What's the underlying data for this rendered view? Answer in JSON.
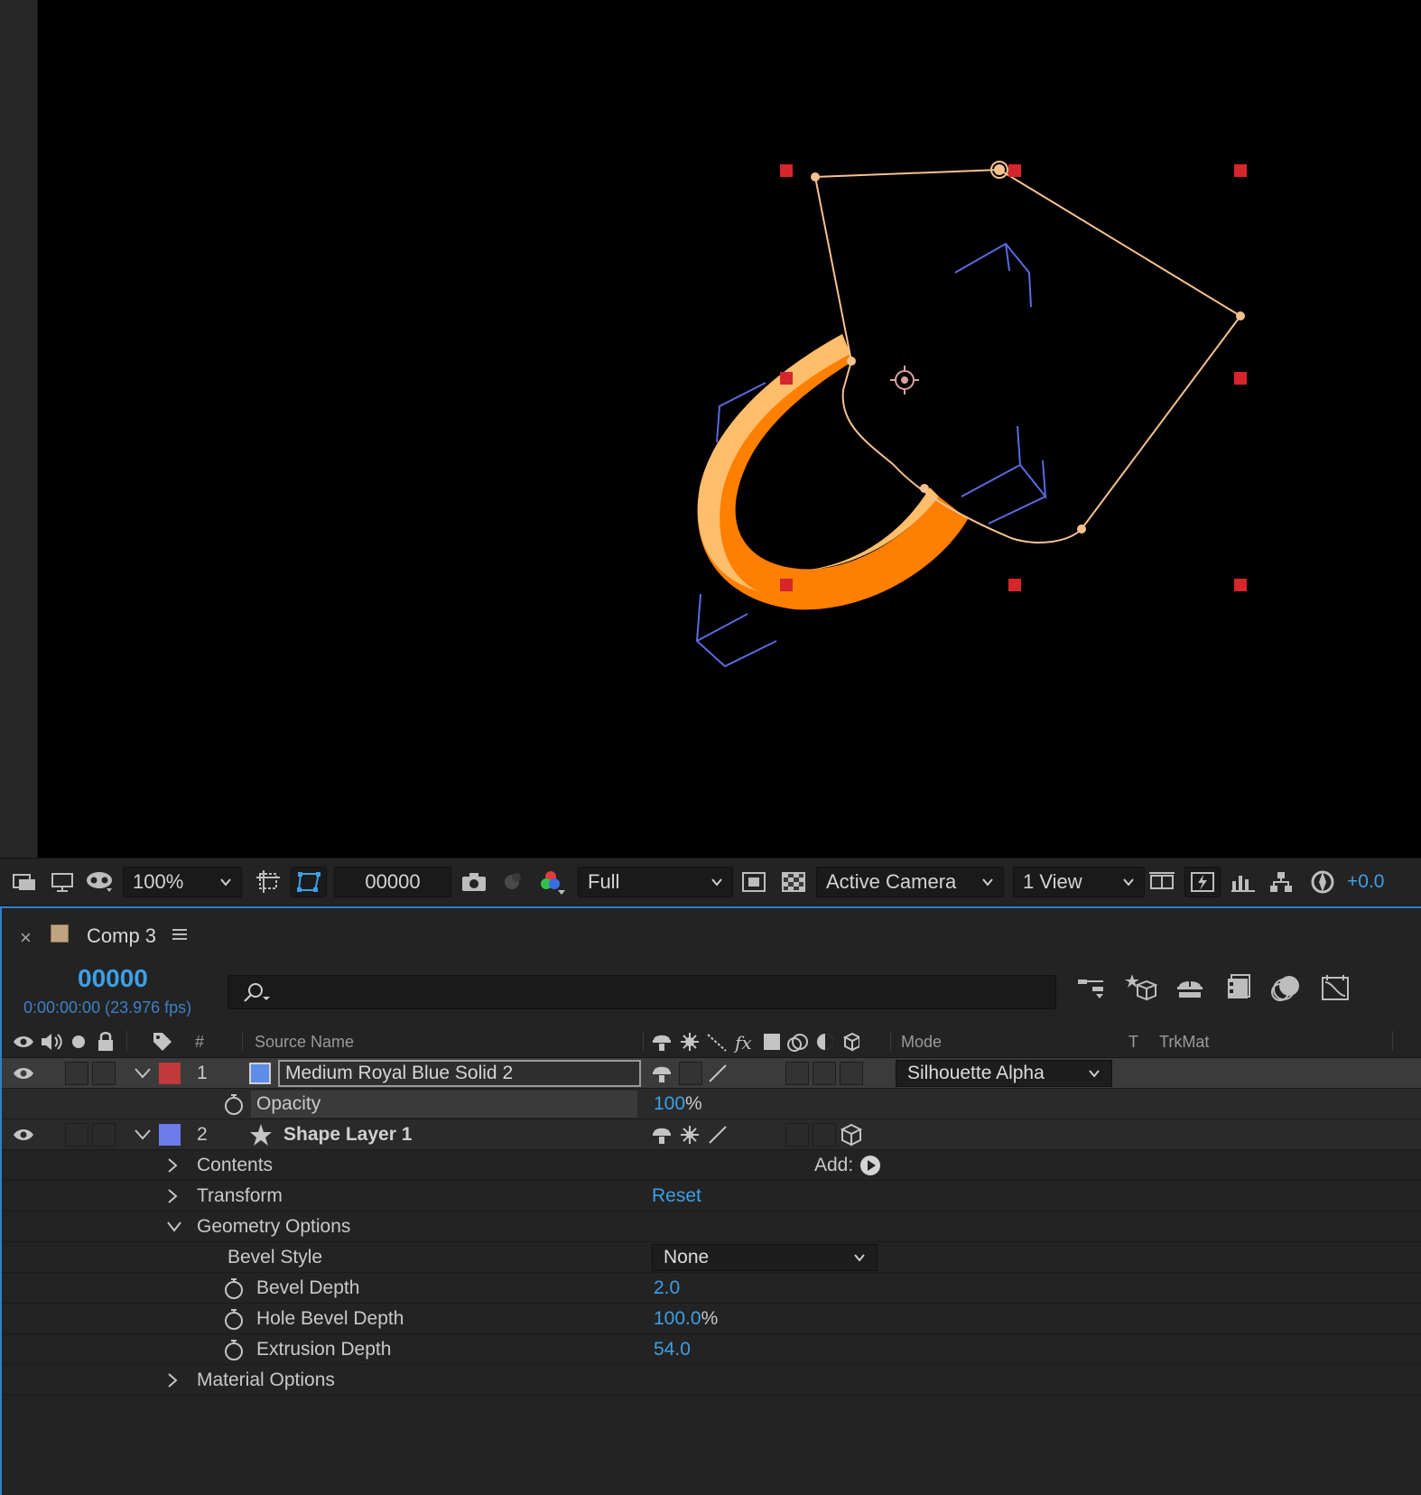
{
  "viewer": {
    "toolbar": {
      "zoom": "100%",
      "frame": "00000",
      "resolution": "Full",
      "camera": "Active Camera",
      "views": "1 View",
      "exposure": "+0.0"
    },
    "colors": {
      "background": "#000000",
      "path": "#f6c190",
      "handles": "#d6262b",
      "axes": "#5b6ae0",
      "ring_outer": "#ff7f00",
      "ring_inner": "#ffbe6b"
    }
  },
  "timeline": {
    "tab": {
      "close": "×",
      "title": "Comp 3"
    },
    "timecode": "00000",
    "timecode_sub": "0:00:00:00 (23.976 fps)",
    "headers": {
      "number": "#",
      "source_name": "Source Name",
      "mode": "Mode",
      "t": "T",
      "trkmat": "TrkMat"
    },
    "layers": [
      {
        "number": "1",
        "name": "Medium Royal Blue Solid 2",
        "label_color": "#c0393b",
        "swatch_color": "#5d8de6",
        "mode": "Silhouette Alpha"
      },
      {
        "number": "2",
        "name": "Shape Layer 1",
        "label_color": "#6d7bea"
      }
    ],
    "opacity": {
      "label": "Opacity",
      "value": "100",
      "unit": "%"
    },
    "contents": {
      "label": "Contents",
      "add_label": "Add:"
    },
    "transform": {
      "label": "Transform",
      "reset": "Reset"
    },
    "geometry": {
      "label": "Geometry Options",
      "bevel_style": {
        "label": "Bevel Style",
        "value": "None"
      },
      "bevel_depth": {
        "label": "Bevel Depth",
        "value": "2.0"
      },
      "hole_bevel_depth": {
        "label": "Hole Bevel Depth",
        "value": "100.0",
        "unit": "%"
      },
      "extrusion_depth": {
        "label": "Extrusion Depth",
        "value": "54.0"
      }
    },
    "material": {
      "label": "Material Options"
    }
  }
}
